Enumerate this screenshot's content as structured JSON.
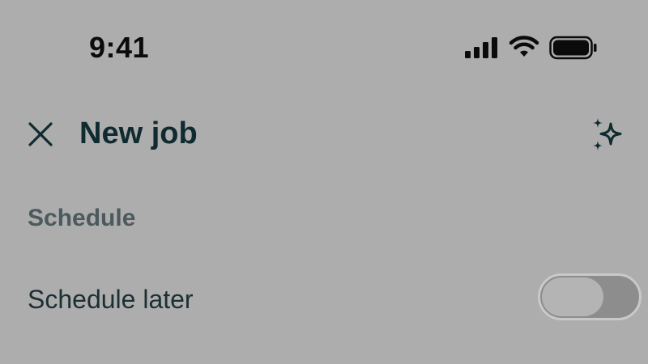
{
  "status_bar": {
    "time": "9:41",
    "icons": [
      "cellular-signal-icon",
      "wifi-icon",
      "battery-icon"
    ]
  },
  "header": {
    "title": "New job",
    "close_icon": "close-icon",
    "action_icon": "sparkle-icon"
  },
  "section": {
    "label": "Schedule"
  },
  "schedule_later": {
    "label": "Schedule later",
    "enabled": false
  },
  "colors": {
    "background": "#adadad",
    "text_primary": "#0f2b30",
    "text_secondary": "#4c5a5e",
    "toggle_track": "#8d8d8d",
    "toggle_knob": "#b4b4b4"
  }
}
